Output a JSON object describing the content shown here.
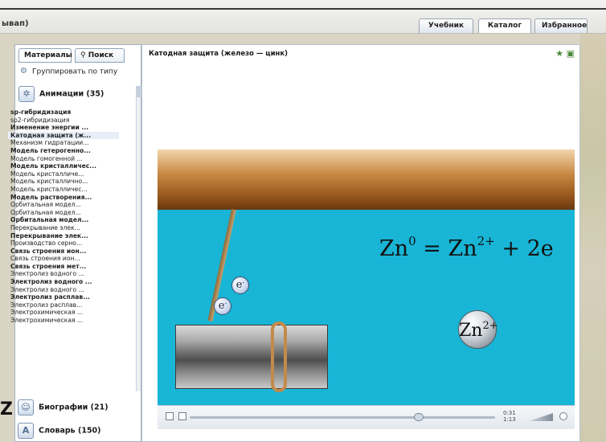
{
  "window": {
    "title_fragment": "ывап)",
    "tabs": [
      "Учебник",
      "Каталог",
      "Избранное"
    ]
  },
  "sidebar": {
    "tabs": [
      "Материалы",
      "Поиск"
    ],
    "group_by_label": "Группировать по типу",
    "sections": [
      {
        "label": "Анимации (35)",
        "icon": "film-icon"
      },
      {
        "label": "Биографии (21)",
        "icon": "person-icon"
      },
      {
        "label": "Словарь (150)",
        "icon": "book-icon"
      }
    ],
    "animations": [
      "sp-гибридизация",
      "sp2-гибридизация",
      "Изменение энергии ...",
      "Катодная защита (ж...",
      "Механизм гидратации...",
      "Модель гетерогенно...",
      "Модель гомогенной ...",
      "Модель кристалличес...",
      "Модель кристалличе...",
      "Модель кристаллично...",
      "Модель кристалличес...",
      "Модель растворения...",
      "Орбитальная модел...",
      "Орбитальная модел...",
      "Орбитальная модел...",
      "Перекрывание элек...",
      "Перекрывание элек...",
      "Производство серно...",
      "Связь строения ион...",
      "Связь строения ион...",
      "Связь строения мет...",
      "Электролиз водного ...",
      "Электролиз водного ...",
      "Электролиз водного ...",
      "Электролиз расплав...",
      "Электролиз расплав...",
      "Электрохимическая ...",
      "Электрохимическая ..."
    ],
    "selected_index": 3
  },
  "content": {
    "title": "Катодная защита (железо — цинк)"
  },
  "animation": {
    "equation_lhs": "Zn",
    "equation_lhs_sup": "0",
    "equation_eq": " = ",
    "equation_rhs": "Zn",
    "equation_rhs_sup": "2+",
    "equation_tail": " + 2e",
    "electron_label": "e",
    "electron_sup": "-",
    "ion_label": "Zn",
    "ion_sup": "2+",
    "colors": {
      "water": "#18b5d6",
      "zinc_bar": "#9b5a1e",
      "iron_rod": "#6b6b6b"
    }
  },
  "player": {
    "time_label": "0:31\n1:13",
    "progress": 0.75
  }
}
